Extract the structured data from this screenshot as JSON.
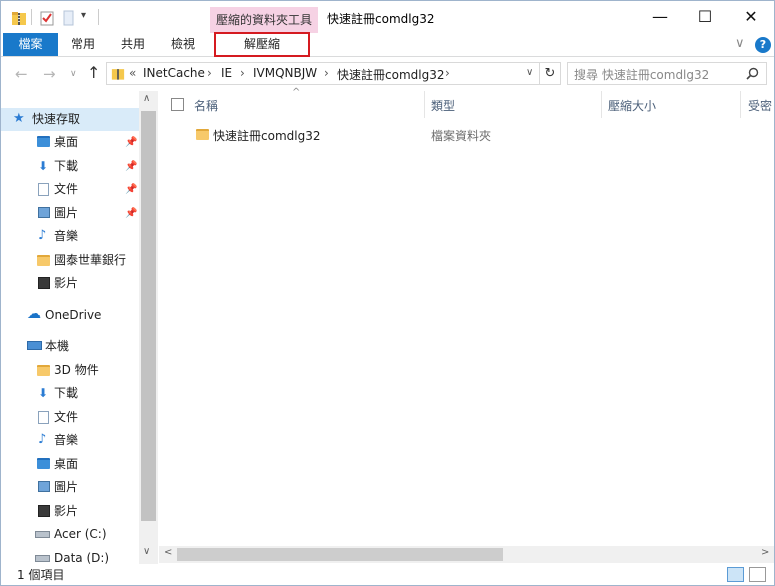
{
  "titlebar": {
    "contextual_group": "壓縮的資料夾工具",
    "title": "快速註冊comdlg32",
    "minimize": "—",
    "maximize": "☐",
    "close": "✕"
  },
  "ribbon": {
    "tabs": [
      "檔案",
      "常用",
      "共用",
      "檢視"
    ],
    "contextual_tab": "解壓縮",
    "accent": "#1979ca",
    "highlight": "#d51a20"
  },
  "address": {
    "prefix": "«",
    "crumbs": [
      "INetCache",
      "IE",
      "IVMQNBJW",
      "快速註冊comdlg32"
    ],
    "search_placeholder": "搜尋 快速註冊comdlg32"
  },
  "nav": {
    "quick_access": "快速存取",
    "quick_items": [
      "桌面",
      "下載",
      "文件",
      "圖片",
      "音樂",
      "國泰世華銀行",
      "影片"
    ],
    "onedrive": "OneDrive",
    "this_pc": "本機",
    "pc_items": [
      "3D 物件",
      "下載",
      "文件",
      "音樂",
      "桌面",
      "圖片",
      "影片",
      "Acer (C:)",
      "Data (D:)"
    ]
  },
  "columns": [
    "名稱",
    "類型",
    "壓縮大小",
    "受密"
  ],
  "files": [
    {
      "name": "快速註冊comdlg32",
      "type": "檔案資料夾"
    }
  ],
  "status": {
    "count": "1 個項目"
  }
}
